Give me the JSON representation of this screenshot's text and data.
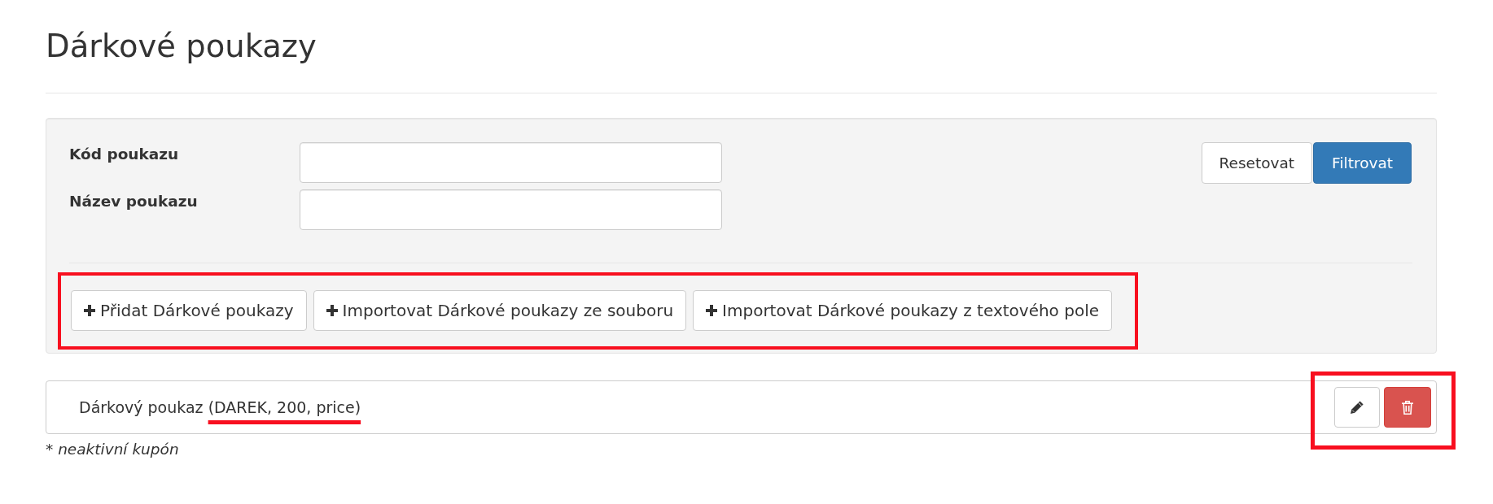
{
  "page": {
    "title": "Dárkové poukazy"
  },
  "filter_panel": {
    "fields": [
      {
        "label": "Kód poukazu"
      },
      {
        "label": "Název poukazu"
      }
    ],
    "buttons": [
      {
        "label": "Resetovat",
        "kind": "default"
      },
      {
        "label": "Filtrovat",
        "kind": "primary"
      }
    ],
    "actions": {
      "highlighted": true,
      "buttons": [
        {
          "label": "Přidat Dárkové poukazy"
        },
        {
          "label": "Importovat Dárkové poukazy ze souboru"
        },
        {
          "label": "Importovat Dárkové poukazy z textového pole"
        }
      ]
    }
  },
  "vouchers": [
    {
      "name": "Dárkový poukaz",
      "details": "(DAREK, 200, price)",
      "details_underlined": true,
      "actions_highlighted": true,
      "buttons": [
        {
          "kind": "edit"
        },
        {
          "kind": "delete"
        }
      ]
    }
  ],
  "footnote": "* neaktivní kupón"
}
